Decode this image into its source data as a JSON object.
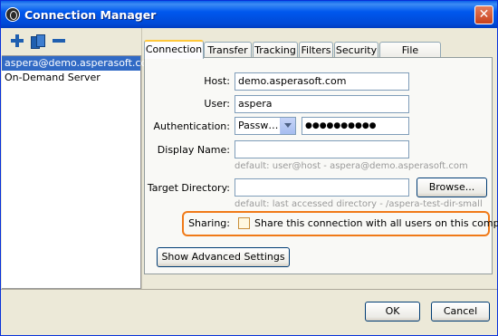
{
  "window": {
    "title": "Connection Manager",
    "close_glyph": "✕"
  },
  "toolbar": {
    "icons": [
      "add-icon",
      "duplicate-icon",
      "remove-icon"
    ]
  },
  "connections": [
    {
      "label": "aspera@demo.asperasoft.com",
      "selected": true
    },
    {
      "label": "On-Demand Server",
      "selected": false
    }
  ],
  "tabs": [
    "Connection",
    "Transfer",
    "Tracking",
    "Filters",
    "Security",
    "File Handling"
  ],
  "active_tab": "Connection",
  "form": {
    "host_label": "Host:",
    "host_value": "demo.asperasoft.com",
    "user_label": "User:",
    "user_value": "aspera",
    "auth_label": "Authentication:",
    "auth_value": "Passw…",
    "password_mask": "●●●●●●●●●●",
    "display_name_label": "Display Name:",
    "display_name_value": "",
    "display_name_hint": "default: user@host - aspera@demo.asperasoft.com",
    "target_dir_label": "Target Directory:",
    "target_dir_value": "",
    "target_dir_hint": "default: last accessed directory - /aspera-test-dir-small",
    "browse_button": "Browse...",
    "sharing_label": "Sharing:",
    "sharing_checkbox_label": "Share this connection with all users on this computer",
    "sharing_checked": false,
    "advanced_button": "Show Advanced Settings"
  },
  "footer": {
    "ok": "OK",
    "cancel": "Cancel"
  },
  "colors": {
    "title_bar": "#0058ee",
    "selection": "#316ac5",
    "highlight": "#f07a18"
  }
}
